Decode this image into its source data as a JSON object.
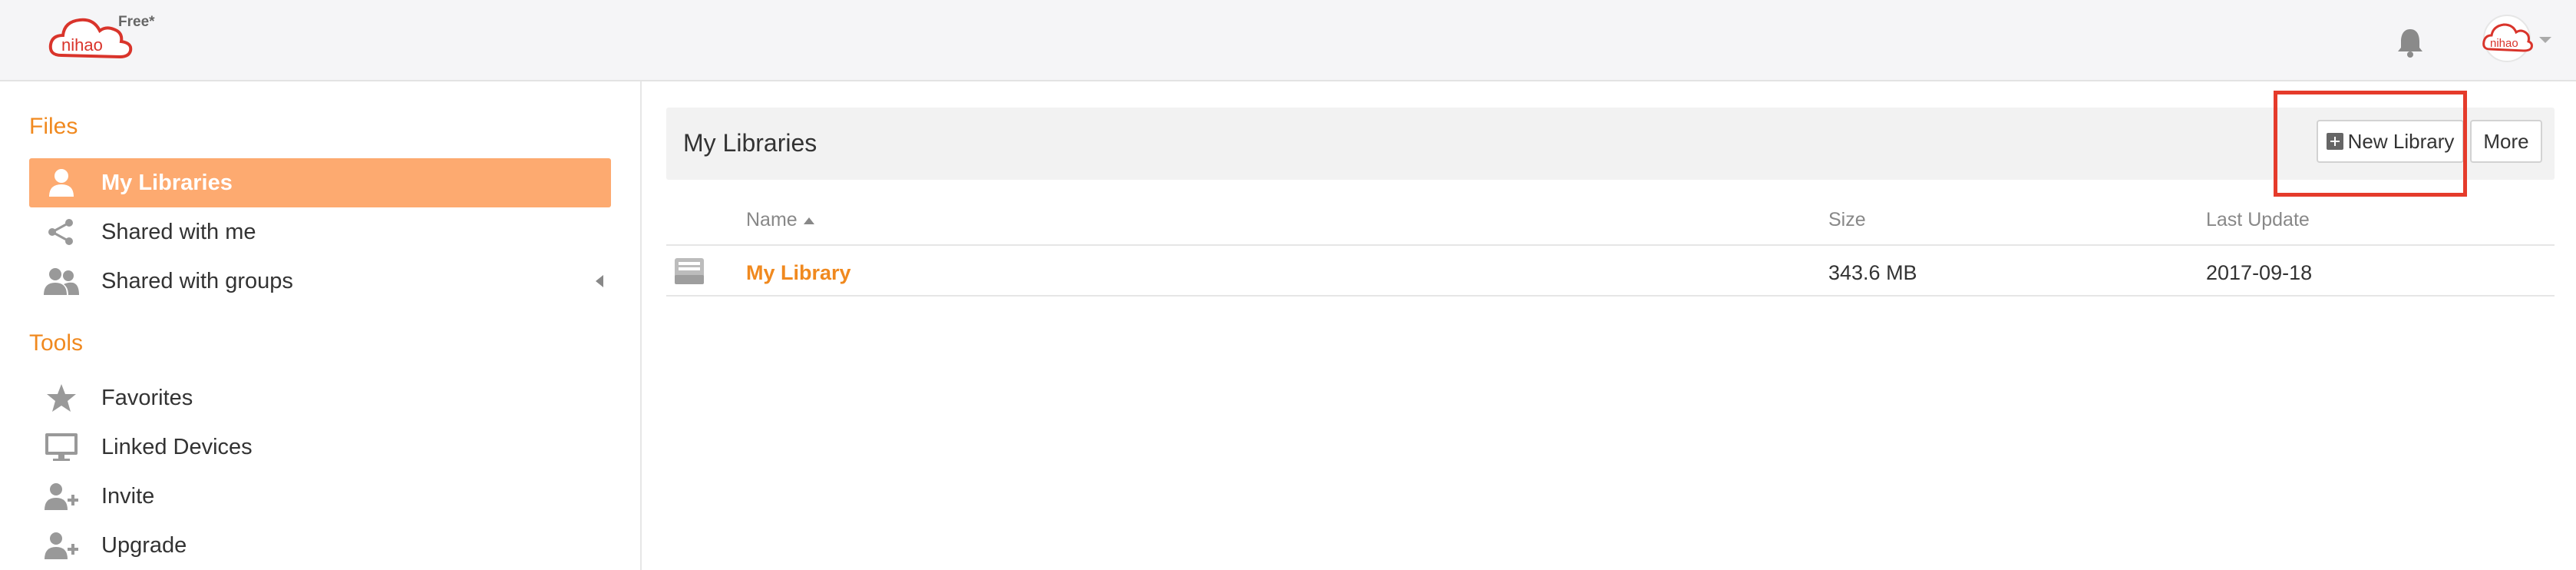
{
  "header": {
    "logo_text": "nihao",
    "plan_badge": "Free*",
    "avatar_text": "nihao"
  },
  "sidebar": {
    "files_title": "Files",
    "tools_title": "Tools",
    "files_items": [
      {
        "label": "My Libraries",
        "icon": "user-icon",
        "active": true
      },
      {
        "label": "Shared with me",
        "icon": "share-icon"
      },
      {
        "label": "Shared with groups",
        "icon": "group-icon"
      }
    ],
    "tools_items": [
      {
        "label": "Favorites",
        "icon": "star-icon"
      },
      {
        "label": "Linked Devices",
        "icon": "monitor-icon"
      },
      {
        "label": "Invite",
        "icon": "add-user-icon"
      },
      {
        "label": "Upgrade",
        "icon": "add-user-icon"
      }
    ]
  },
  "main": {
    "title": "My Libraries",
    "new_library_label": "New Library",
    "more_label": "More",
    "columns": [
      "Name",
      "Size",
      "Last Update"
    ],
    "rows": [
      {
        "name": "My Library",
        "size": "343.6 MB",
        "last_update": "2017-09-18"
      }
    ]
  },
  "colors": {
    "accent": "#f0891f",
    "active_bg": "#fdaa70",
    "highlight": "#e53b2b",
    "logo_red": "#d9342b"
  }
}
